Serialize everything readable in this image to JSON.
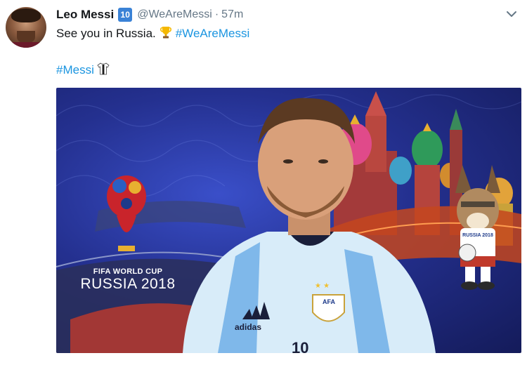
{
  "tweet": {
    "author_name": "Leo Messi",
    "verified_badge": "10",
    "handle": "@WeAreMessi",
    "separator": "·",
    "time": "57m",
    "text_main": "See you in Russia.",
    "hashtag_1": "#WeAreMessi",
    "hashtag_2": "#Messi"
  },
  "media": {
    "logo_line_1": "FIFA WORLD CUP",
    "logo_line_2": "RUSSIA 2018",
    "jersey_brand": "adidas",
    "jersey_crest": "AFA",
    "jersey_number": "10",
    "mascot_shirt_text": "RUSSIA 2018"
  },
  "icons": {
    "badge": "number-ten-badge-icon",
    "more": "chevron-down-icon",
    "trophy": "trophy-emoji-icon",
    "shirt": "argentina-shirt-emoji-icon"
  },
  "colors": {
    "hashtag": "#1b95e0",
    "muted": "#657786",
    "badge": "#3a82d6"
  }
}
